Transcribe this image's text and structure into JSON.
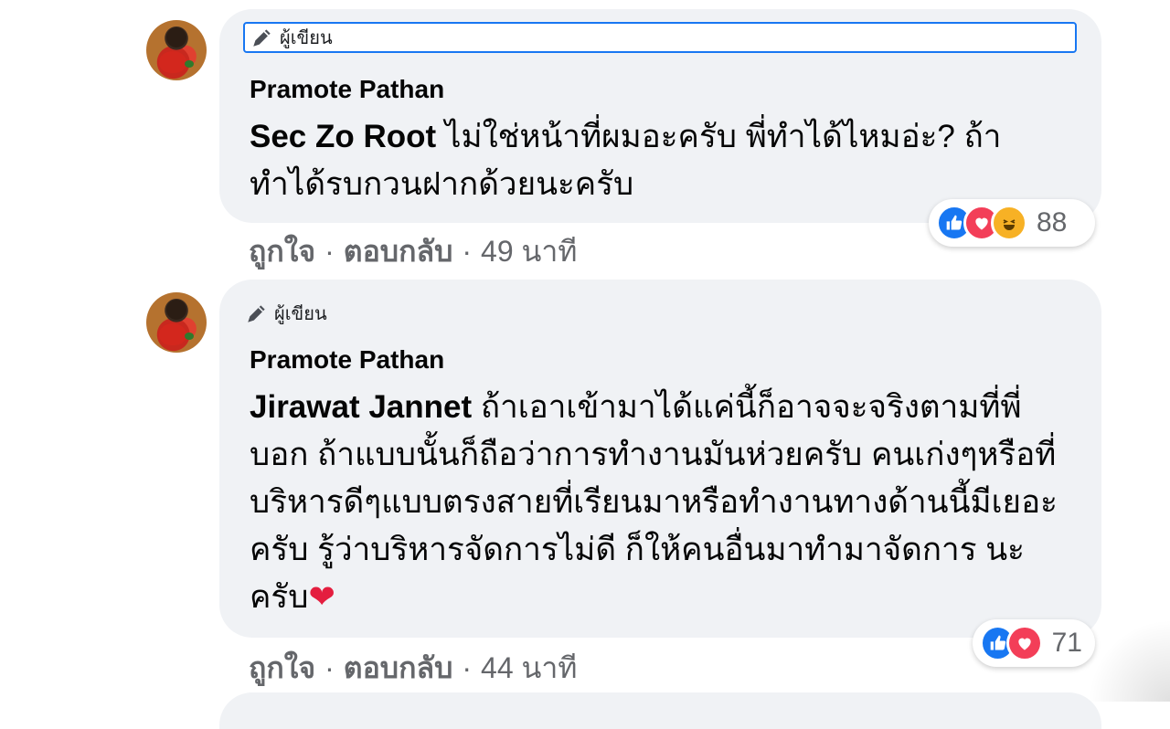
{
  "comments": [
    {
      "author_badge": "ผู้เขียน",
      "author_name": "Pramote Pathan",
      "mention": "Sec Zo Root",
      "text": " ไม่ใช่หน้าที่ผมอะครับ พี่ทำได้ไหมอ่ะ? ถ้าทำได้รบกวนฝากด้วยนะครับ",
      "like_label": "ถูกใจ",
      "reply_label": "ตอบกลับ",
      "separator": "·",
      "time": "49 นาที",
      "reaction_icons": [
        "like-icon",
        "love-icon",
        "haha-icon"
      ],
      "reaction_count": "88"
    },
    {
      "author_badge": "ผู้เขียน",
      "author_name": "Pramote Pathan",
      "mention": "Jirawat Jannet",
      "text": " ถ้าเอาเข้ามาได้แค่นี้ก็อาจจะจริงตามที่พี่บอก ถ้าแบบนั้นก็ถือว่าการทำงานมันห่วยครับ คนเก่งๆหรือที่บริหารดีๆแบบตรงสายที่เรียนมาหรือทำงานทางด้านนี้มีเยอะครับ รู้ว่าบริหารจัดการไม่ดี ก็ให้คนอื่นมาทำมาจัดการ นะครับ",
      "heart": "❤",
      "like_label": "ถูกใจ",
      "reply_label": "ตอบกลับ",
      "separator": "·",
      "time": "44 นาที",
      "reaction_icons": [
        "like-icon",
        "love-icon"
      ],
      "reaction_count": "71"
    }
  ],
  "colors": {
    "bubble": "#f0f2f5",
    "like": "#1877f2",
    "love": "#f33e58",
    "haha": "#f7b125",
    "meta_text": "#65676b"
  }
}
